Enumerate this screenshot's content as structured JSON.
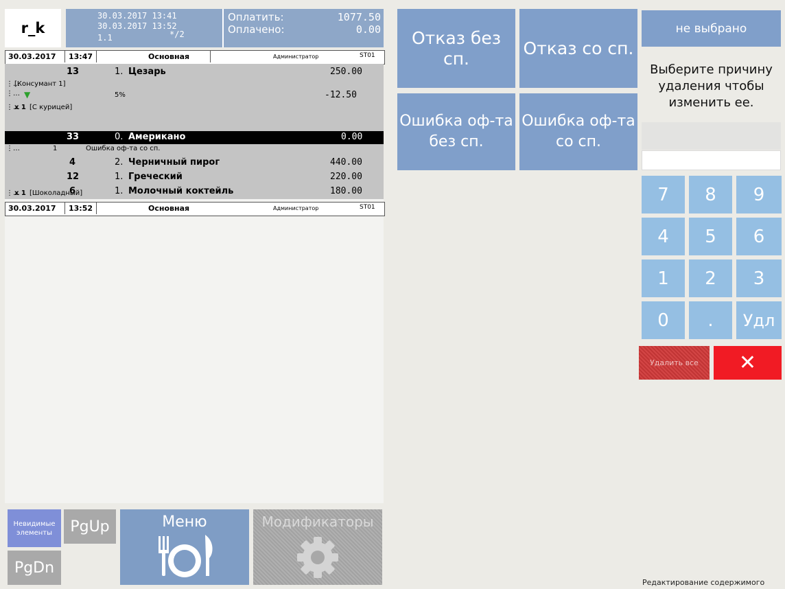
{
  "header": {
    "logo": "r_k",
    "date_open": "30.03.2017 13:41",
    "date_now": "30.03.2017 13:52",
    "table": "1.1",
    "guests": "*/2",
    "to_pay_label": "Оплатить:",
    "to_pay_value": "1077.50",
    "paid_label": "Оплачено:",
    "paid_value": "0.00"
  },
  "sections": [
    {
      "date": "30.03.2017",
      "time": "13:47",
      "name": "Основная",
      "user": "Администратор",
      "station": "ST01"
    },
    {
      "date": "30.03.2017",
      "time": "13:52",
      "name": "Основная",
      "user": "Администратор",
      "station": "ST01"
    }
  ],
  "order": {
    "item1": {
      "code": "13",
      "qty": "1.",
      "name": "Цезарь",
      "price": "250.00"
    },
    "consumer": "[Консумант 1]",
    "discount_pct": "5%",
    "discount_value": "-12.50",
    "mod1_qty": "x 1",
    "mod1_name": "[С курицей]",
    "item2": {
      "code": "33",
      "qty": "0.",
      "name": "Американо",
      "price": "0.00"
    },
    "void_qty": "1",
    "void_reason": "Ошибка оф-та со сп.",
    "item3": {
      "code": "4",
      "qty": "2.",
      "name": "Черничный пирог",
      "price": "440.00"
    },
    "item4": {
      "code": "12",
      "qty": "1.",
      "name": "Греческий",
      "price": "220.00"
    },
    "item5": {
      "code": "6",
      "qty": "1.",
      "name": "Молочный коктейль",
      "price": "180.00"
    },
    "mod2_qty": "x 1",
    "mod2_name": "[Шоколадный]"
  },
  "bottom": {
    "invisible": "Невидимые элементы",
    "pgup": "PgUp",
    "pgdn": "PgDn",
    "menu": "Меню",
    "modifiers": "Модификаторы"
  },
  "reasons": {
    "r1": "Отказ без сп.",
    "r2": "Отказ со сп.",
    "r3": "Ошибка оф-та без сп.",
    "r4": "Ошибка оф-та со сп."
  },
  "right": {
    "not_selected": "не выбрано",
    "hint": "Выберите причину удаления чтобы изменить ее.",
    "input_value": "",
    "keys": [
      "7",
      "8",
      "9",
      "4",
      "5",
      "6",
      "1",
      "2",
      "3",
      "0",
      ".",
      "Удл"
    ],
    "delete_all": "Удалить все",
    "cancel": "✕",
    "status": "Редактирование содержимого"
  },
  "colors": {
    "accent_blue": "#809fca",
    "key_blue": "#95bfe3",
    "cancel_red": "#f11b24"
  }
}
